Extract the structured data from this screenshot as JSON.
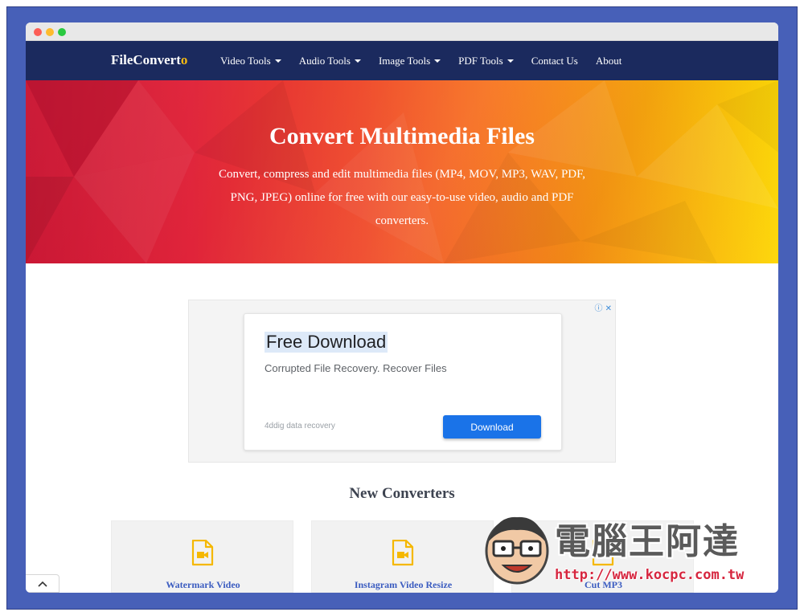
{
  "navbar": {
    "logo_main": "FileConvert",
    "logo_accent": "o",
    "items": [
      {
        "label": "Video Tools",
        "dropdown": true
      },
      {
        "label": "Audio Tools",
        "dropdown": true
      },
      {
        "label": "Image Tools",
        "dropdown": true
      },
      {
        "label": "PDF Tools",
        "dropdown": true
      },
      {
        "label": "Contact Us",
        "dropdown": false
      },
      {
        "label": "About",
        "dropdown": false
      }
    ]
  },
  "hero": {
    "title": "Convert Multimedia Files",
    "description": "Convert, compress and edit multimedia files (MP4, MOV, MP3, WAV, PDF, PNG, JPEG) online for free with our easy-to-use video, audio and PDF converters."
  },
  "ad": {
    "choices_label": "ⓘ ✕",
    "title": "Free Download",
    "subtitle": "Corrupted File Recovery. Recover Files",
    "brand": "4ddig data recovery",
    "button_label": "Download"
  },
  "converters": {
    "title": "New Converters",
    "items": [
      {
        "label": "Watermark Video",
        "icon": "video-file-icon"
      },
      {
        "label": "Instagram Video Resize",
        "icon": "video-file-icon"
      },
      {
        "label": "Cut MP3",
        "icon": "video-file-icon"
      }
    ]
  },
  "watermark": {
    "text": "電腦王阿達",
    "url": "http://www.kocpc.com.tw"
  },
  "colors": {
    "navbar_bg": "#1b2a5e",
    "logo_accent": "#f6b912",
    "hero_start": "#c8102e",
    "hero_end": "#fdd500",
    "link": "#3b5cc0",
    "ad_button": "#1a73e8",
    "frame": "#4760b8"
  }
}
